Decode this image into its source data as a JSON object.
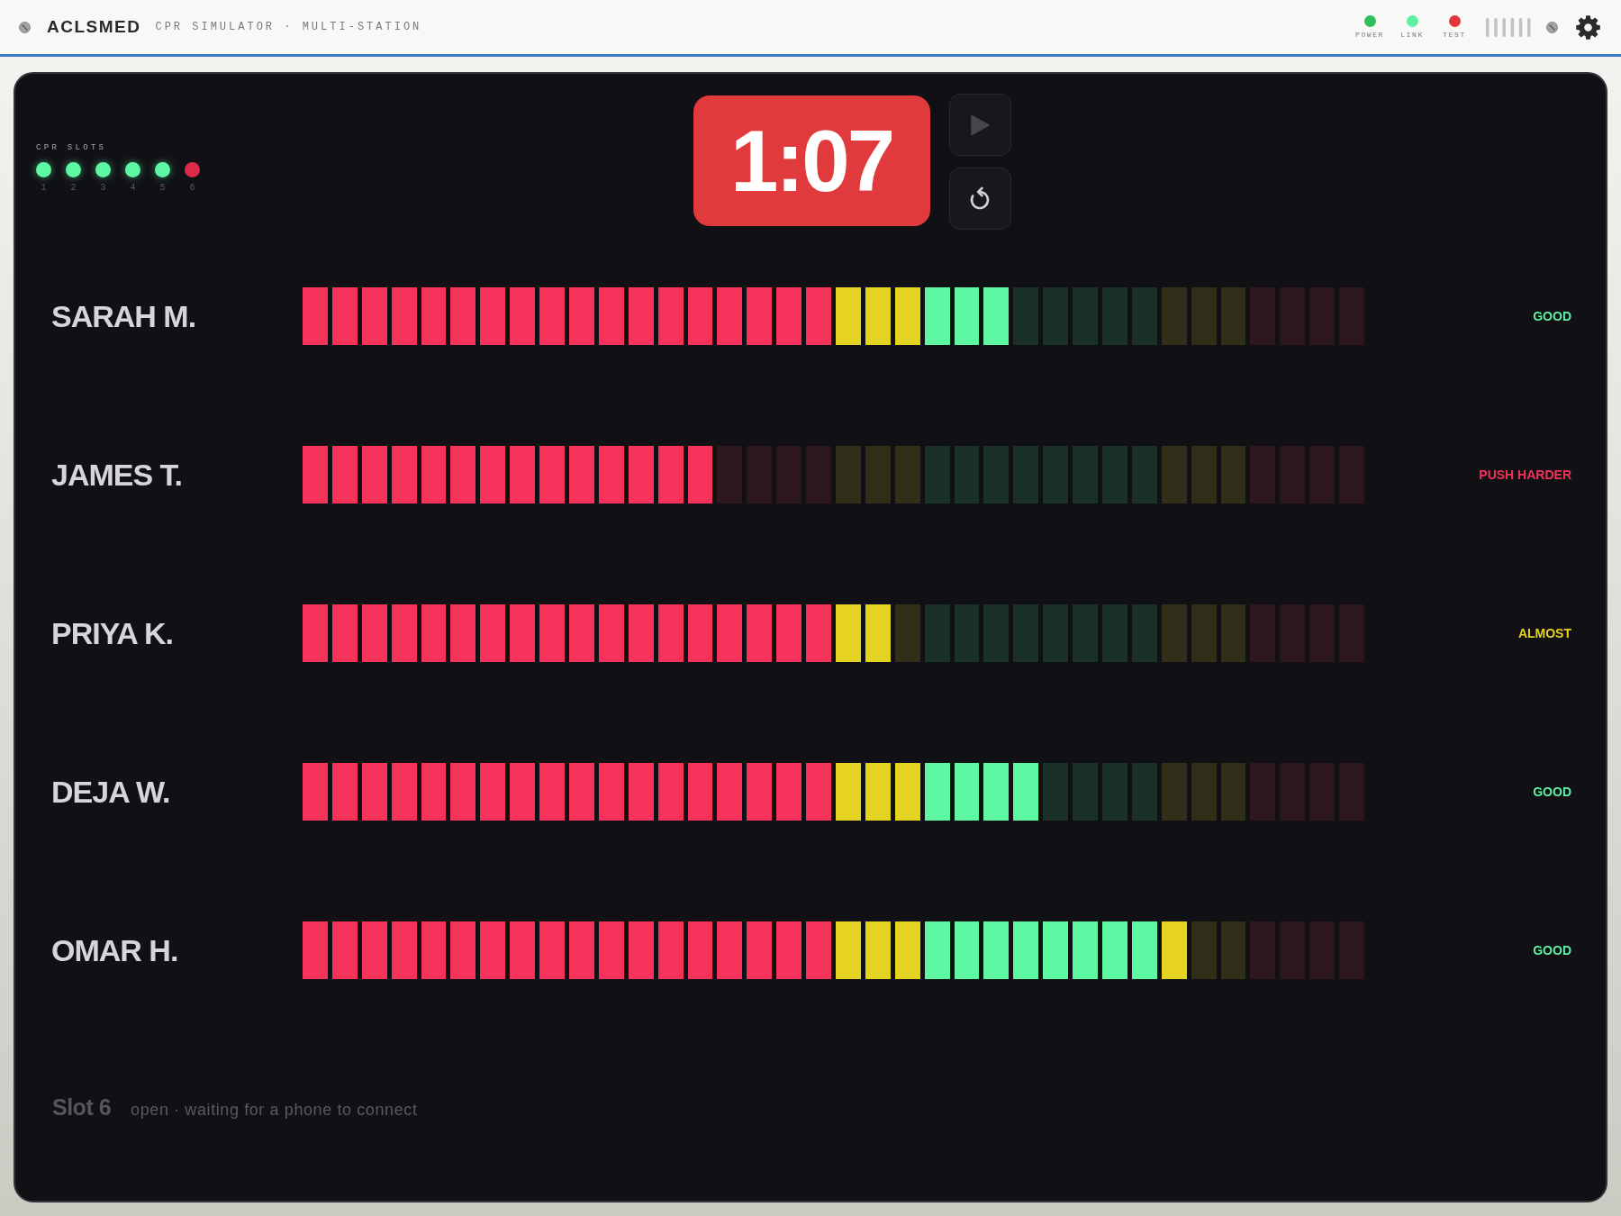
{
  "header": {
    "brand": "ACLSMED",
    "subtitle": "CPR SIMULATOR · MULTI-STATION",
    "indicators": [
      {
        "label": "POWER",
        "color": "#2fbf5b"
      },
      {
        "label": "LINK",
        "color": "#5ef0a3"
      },
      {
        "label": "TEST",
        "color": "#e2363a"
      }
    ]
  },
  "slots": {
    "label": "CPR SLOTS",
    "items": [
      {
        "number": "1",
        "color": "#5ef7a3"
      },
      {
        "number": "2",
        "color": "#5ef7a3"
      },
      {
        "number": "3",
        "color": "#5ef7a3"
      },
      {
        "number": "4",
        "color": "#5ef7a3"
      },
      {
        "number": "5",
        "color": "#5ef7a3"
      },
      {
        "number": "6",
        "color": "#dd2a4a"
      }
    ]
  },
  "timer": {
    "time": "1:07"
  },
  "trainees": [
    {
      "name": "SARAH M.",
      "level": 0.667,
      "status": {
        "text": "GOOD",
        "color": "#5ef0a3"
      }
    },
    {
      "name": "JAMES T.",
      "level": 0.389,
      "status": {
        "text": "PUSH HARDER",
        "color": "#f0335a"
      }
    },
    {
      "name": "PRIYA K.",
      "level": 0.556,
      "status": {
        "text": "ALMOST",
        "color": "#e5d21f"
      }
    },
    {
      "name": "DEJA W.",
      "level": 0.694,
      "status": {
        "text": "GOOD",
        "color": "#5ef0a3"
      }
    },
    {
      "name": "OMAR H.",
      "level": 0.833,
      "status": {
        "text": "GOOD",
        "color": "#5ef0a3"
      }
    }
  ],
  "open_slot": {
    "title": "Slot 6",
    "message": "open · waiting for a phone to connect"
  }
}
